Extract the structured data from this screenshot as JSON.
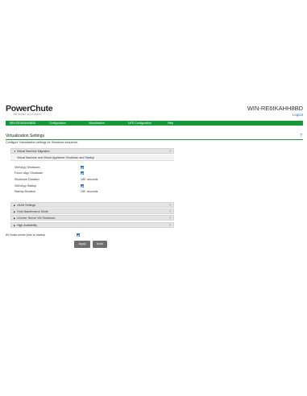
{
  "app": {
    "brand": "PowerChute",
    "brand_sub": "NETWORK SHUTDOWN",
    "hostname": "WIN-RE6IKAHH8BD",
    "logout": "Logout"
  },
  "nav": {
    "items": [
      {
        "label": "WIN-RE6IKAHH8BD"
      },
      {
        "label": "Configuration"
      },
      {
        "label": "Virtualization"
      },
      {
        "label": "UPS Configuration"
      },
      {
        "label": "Help"
      }
    ]
  },
  "page": {
    "title": "Virtualization Settings",
    "help": "?",
    "description": "Configure Virtualization settings for Shutdown sequence."
  },
  "sections": {
    "vm_migration": {
      "caret": "▼",
      "title": "Virtual Machine Migration",
      "help": "?"
    },
    "subsection": {
      "title": "Virtual Machine and Virtual Appliance Shutdown and Startup"
    },
    "vsan": {
      "caret": "▶",
      "title": "vSAN Settings",
      "help": "?"
    },
    "maintenance": {
      "caret": "▶",
      "title": "Host Maintenance Mode",
      "help": "?"
    },
    "vcenter": {
      "caret": "▶",
      "title": "vCenter Server VM Shutdown",
      "help": "?"
    },
    "ha": {
      "caret": "▶",
      "title": "High Availability",
      "help": "?"
    }
  },
  "fields": {
    "vm_vapp_shutdown": {
      "label": "VM/vApp Shutdown",
      "checked": true
    },
    "force_vapp_shutdown": {
      "label": "Force vApp Shutdown",
      "checked": true
    },
    "shutdown_duration": {
      "label": "Shutdown Duration",
      "value": "180",
      "unit": "seconds"
    },
    "vm_vapp_startup": {
      "label": "VM/vApp Startup",
      "checked": true
    },
    "startup_duration": {
      "label": "Startup Duration",
      "value": "150",
      "unit": "seconds"
    }
  },
  "all_hosts": {
    "label": "All Hosts online prior to startup",
    "checked": true
  },
  "buttons": {
    "apply": "Apply",
    "undo": "Undo"
  },
  "colors": {
    "nav_green": "#16993b",
    "checkbox_blue": "#1f6fd6",
    "button_gray": "#6f6f6f"
  }
}
